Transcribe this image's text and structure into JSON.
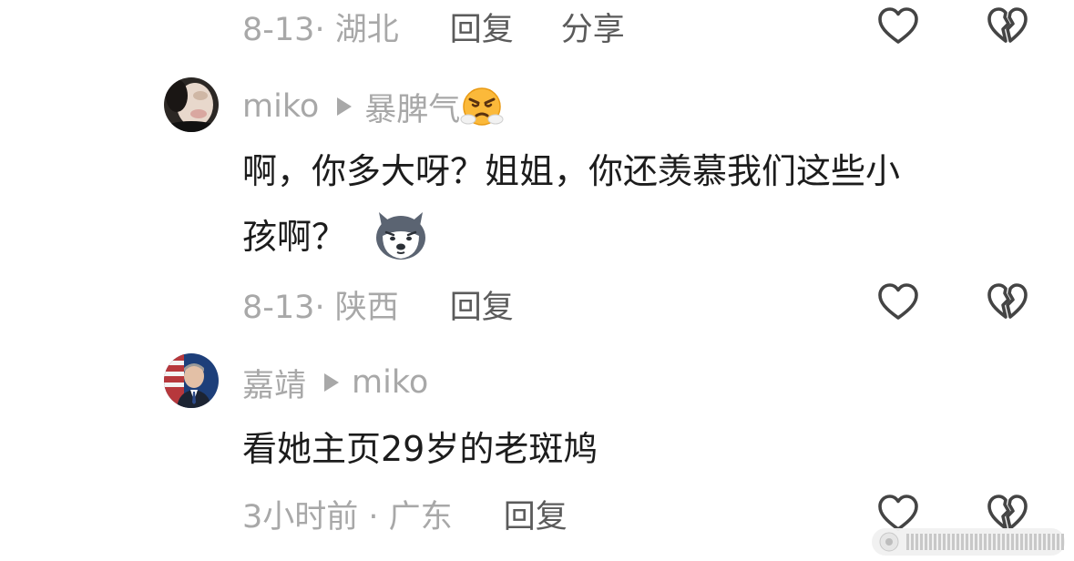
{
  "comments": [
    {
      "meta": {
        "time": "8-13",
        "location": "湖北",
        "reply_label": "回复",
        "share_label": "分享"
      }
    },
    {
      "user": "miko",
      "reply_to": "暴脾气",
      "reply_to_emoji": "angry-steam-face",
      "text_line1": "啊，你多大呀？姐姐，你还羡慕我们这些小",
      "text_line2": "孩啊？",
      "text_emoji": "husky-dog-face",
      "meta": {
        "time": "8-13",
        "location": "陕西",
        "reply_label": "回复"
      }
    },
    {
      "user": "嘉靖",
      "reply_to": "miko",
      "text": "看她主页29岁的老斑鸠",
      "meta": {
        "time": "3小时前",
        "location": "广东",
        "reply_label": "回复"
      }
    }
  ],
  "icons": {
    "like": "heart-outline-icon",
    "dislike": "broken-heart-icon"
  },
  "colors": {
    "meta_text": "#a8a8a8",
    "action_text": "#5b5b5b",
    "content_text": "#1c1c1c",
    "icon_stroke": "#444444"
  }
}
